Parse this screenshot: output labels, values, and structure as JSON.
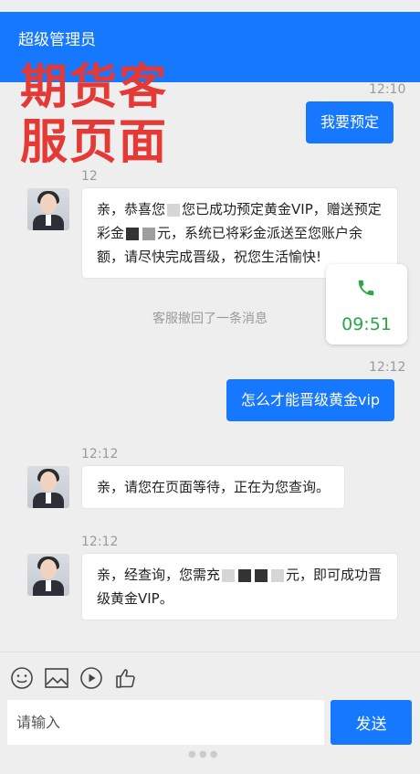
{
  "header": {
    "title": "超级管理员"
  },
  "overlay_caption": [
    "期货客",
    "服页面"
  ],
  "messages": [
    {
      "time": "12:10",
      "side": "right",
      "text": "我要预定"
    },
    {
      "time": "12",
      "side": "left",
      "text_parts": [
        "亲，恭喜您",
        "您已成功预定黄金VIP，赠送预定彩金",
        "元，系统已将彩金派送至您账户余额，",
        "请尽快完成晋级，祝您生活愉快!"
      ]
    },
    {
      "system": "客服撤回了一条消息"
    },
    {
      "time": "12:12",
      "side": "right",
      "text": "怎么才能晋级黄金vip"
    },
    {
      "time": "12:12",
      "side": "left",
      "text": "亲，请您在页面等待，正在为您查询。"
    },
    {
      "time": "12:12",
      "side": "left",
      "text_parts": [
        "亲，经查询，您需充",
        "元，即可成功晋级黄金VIP。"
      ]
    }
  ],
  "call_card": {
    "time": "09:51",
    "icon": "phone-icon",
    "color": "#28a745"
  },
  "toolbar": {
    "icons": [
      "emoji-icon",
      "image-icon",
      "video-play-icon",
      "thumbs-up-icon"
    ]
  },
  "composer": {
    "placeholder": "请输入",
    "send_label": "发送"
  },
  "colors": {
    "accent": "#1677ff",
    "caption": "#e53935"
  }
}
